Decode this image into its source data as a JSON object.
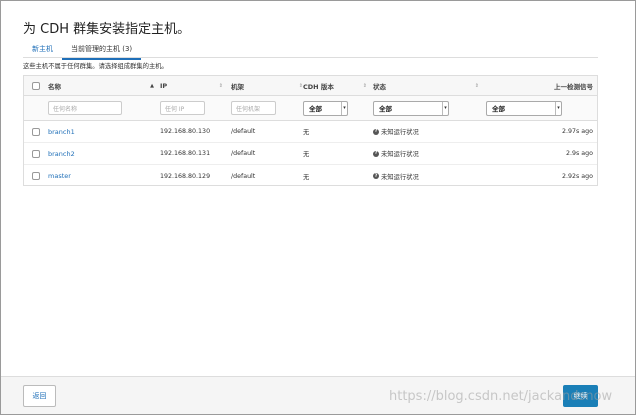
{
  "page": {
    "title": "为 CDH 群集安装指定主机。"
  },
  "tabs": [
    {
      "label": "新主机"
    },
    {
      "label": "当前管理的主机 (3)"
    }
  ],
  "notice": "这些主机不属于任何群集。请选择组成群集的主机。",
  "table": {
    "headers": {
      "name": "名称",
      "ip": "IP",
      "rack": "机架",
      "cdh_version": "CDH 版本",
      "status": "状态",
      "last_heartbeat": "上一检测信号"
    },
    "filters": {
      "name_placeholder": "任何名称",
      "ip_placeholder": "任何 IP",
      "rack_placeholder": "任何机架",
      "cdh_version_value": "全部",
      "status_value": "全部",
      "heartbeat_value": "全部"
    },
    "rows": [
      {
        "name": "branch1",
        "ip": "192.168.80.130",
        "rack": "/default",
        "cdh_version": "无",
        "status": "未知运行状况",
        "last_heartbeat": "2.97s ago"
      },
      {
        "name": "branch2",
        "ip": "192.168.80.131",
        "rack": "/default",
        "cdh_version": "无",
        "status": "未知运行状况",
        "last_heartbeat": "2.9s ago"
      },
      {
        "name": "master",
        "ip": "192.168.80.129",
        "rack": "/default",
        "cdh_version": "无",
        "status": "未知运行状况",
        "last_heartbeat": "2.92s ago"
      }
    ]
  },
  "footer": {
    "back_label": "返回",
    "next_label": "继续"
  },
  "watermark": "https://blog.csdn.net/jackandsnow",
  "colors": {
    "link": "#1f6fb8",
    "primary_button": "#1a7fb7"
  }
}
